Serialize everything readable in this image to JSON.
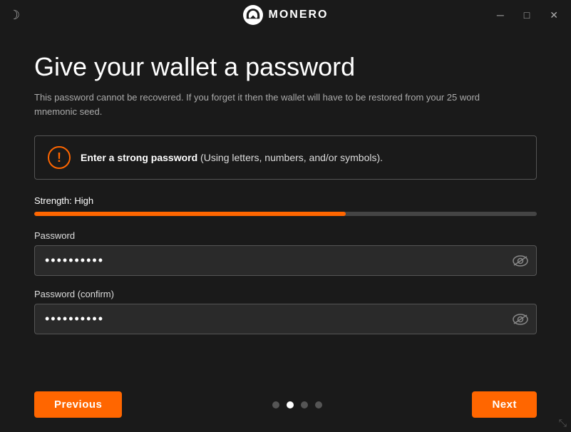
{
  "titlebar": {
    "title": "MONERO",
    "moon_icon": "☽",
    "minimize_label": "─",
    "maximize_label": "□",
    "close_label": "✕"
  },
  "page": {
    "title": "Give your wallet a password",
    "subtitle": "This password cannot be recovered. If you forget it then the wallet will have to be restored from your 25 word mnemonic seed.",
    "warning_text_bold": "Enter a strong password",
    "warning_text_rest": " (Using letters, numbers, and/or symbols).",
    "strength_label": "Strength: High",
    "strength_percent": 62,
    "password_label": "Password",
    "password_value": "••••••••••",
    "password_confirm_label": "Password (confirm)",
    "password_confirm_value": "••••••••••"
  },
  "navigation": {
    "previous_label": "Previous",
    "next_label": "Next",
    "dots": [
      {
        "active": false
      },
      {
        "active": true
      },
      {
        "active": false
      },
      {
        "active": false
      }
    ]
  }
}
